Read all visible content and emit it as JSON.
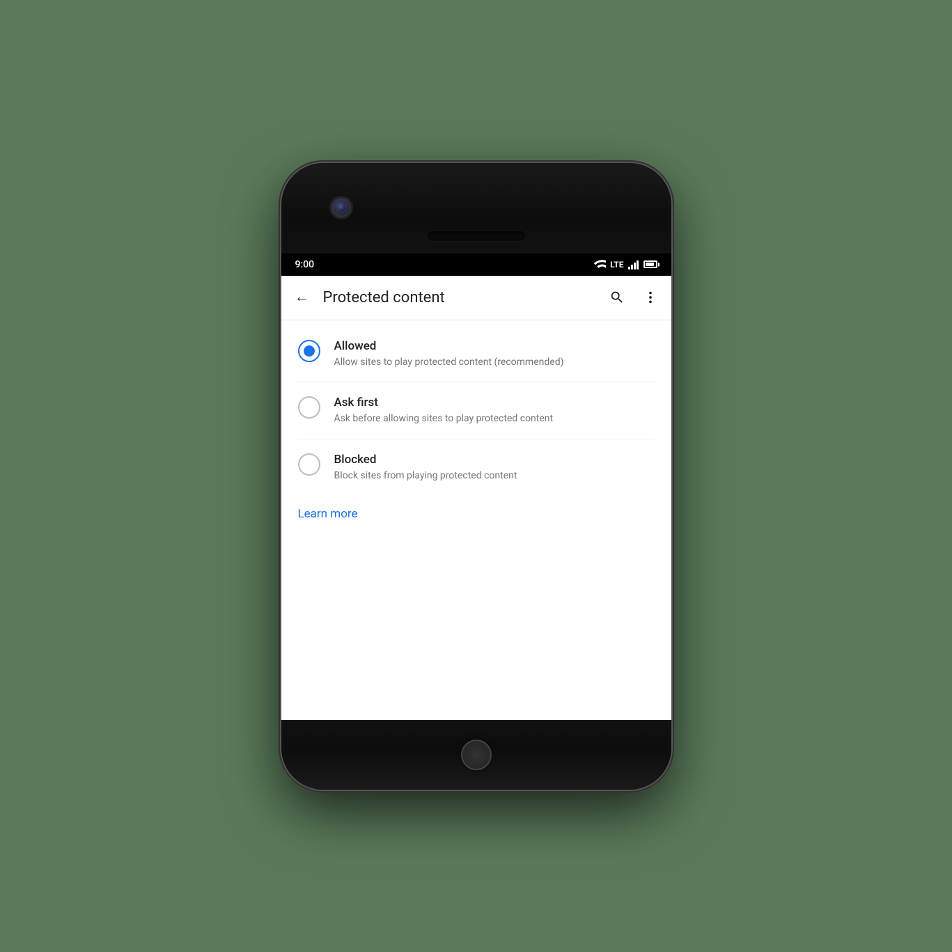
{
  "statusBar": {
    "time": "9:00",
    "lte": "LTE"
  },
  "appBar": {
    "title": "Protected content",
    "backLabel": "←",
    "searchAriaLabel": "Search",
    "moreAriaLabel": "More options"
  },
  "options": [
    {
      "id": "allowed",
      "title": "Allowed",
      "description": "Allow sites to play protected content (recommended)",
      "selected": true
    },
    {
      "id": "ask-first",
      "title": "Ask first",
      "description": "Ask before allowing sites to play protected content",
      "selected": false
    },
    {
      "id": "blocked",
      "title": "Blocked",
      "description": "Block sites from playing protected content",
      "selected": false
    }
  ],
  "learnMore": {
    "label": "Learn more"
  }
}
